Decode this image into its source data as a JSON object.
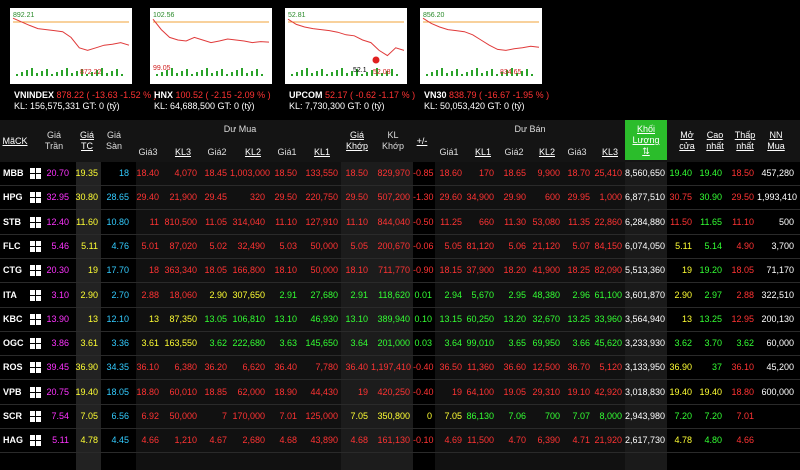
{
  "indices": [
    {
      "name": "VNINDEX",
      "price": "878.22",
      "change": "-13.63",
      "pct": "-1.52 %",
      "kl": "KL: 156,575,331",
      "gt": "GT: 0 (tỷ)",
      "hi": "892.21",
      "lo": "872.22",
      "series": [
        0.92,
        0.85,
        0.78,
        0.72,
        0.7,
        0.68,
        0.66,
        0.55,
        0.35,
        0.3,
        0.35,
        0.4,
        0.42,
        0.45,
        0.4
      ]
    },
    {
      "name": "HNX",
      "price": "100.52",
      "change": "-2.15",
      "pct": "-2.09 %",
      "kl": "KL: 64,688,500",
      "gt": "GT: 0 (tỷ)",
      "hi": "102.56",
      "lo": "99.05",
      "series": [
        0.9,
        0.7,
        0.55,
        0.5,
        0.48,
        0.55,
        0.5,
        0.45,
        0.48,
        0.52,
        0.5,
        0.48,
        0.45,
        0.47,
        0.46
      ]
    },
    {
      "name": "UPCOM",
      "price": "52.17",
      "change": "-0.62",
      "pct": "-1.17 %",
      "kl": "KL: 7,730,300",
      "gt": "GT: 0 (tỷ)",
      "hi": "52.81",
      "lo": "52.08",
      "marker": "52.1",
      "series": [
        0.9,
        0.8,
        0.75,
        0.72,
        0.7,
        0.68,
        0.65,
        0.6,
        0.58,
        0.5,
        0.45,
        0.3,
        0.2,
        0.35,
        0.3
      ]
    },
    {
      "name": "VN30",
      "price": "838.79",
      "change": "-16.67",
      "pct": "-1.95 %",
      "kl": "KL: 50,053,420",
      "gt": "GT: 0 (tỷ)",
      "hi": "856.20",
      "lo": "834.65",
      "series": [
        0.92,
        0.82,
        0.75,
        0.7,
        0.68,
        0.66,
        0.6,
        0.5,
        0.4,
        0.32,
        0.3,
        0.33,
        0.35,
        0.38,
        0.36
      ]
    }
  ],
  "headers": {
    "symbol": "MãCK",
    "tran": "Giá\nTrần",
    "tc": "Giá\nTC",
    "san": "Giá\nSàn",
    "du_mua": "Dư Mua",
    "du_ban": "Dư Bán",
    "gia3": "Giá3",
    "kl3": "KL3",
    "gia2": "Giá2",
    "kl2": "KL2",
    "gia1": "Giá1",
    "kl1": "KL1",
    "gia_khop": "Giá\nKhớp",
    "kl_khop": "KL\nKhớp",
    "pm": "+/-",
    "khoi_luong": "Khối\nLượng\n⇅",
    "mo_cua": "Mở\ncửa",
    "cao_nhat": "Cao\nnhất",
    "thap_nhat": "Thấp\nnhất",
    "nn_mua": "NN\nMua"
  },
  "rows": [
    {
      "sym": "MBB",
      "tran": "20.70",
      "tc": "19.35",
      "san": "18",
      "b3": "18.40",
      "bk3": "4,070",
      "b2": "18.45",
      "bk2": "1,003,000",
      "b1": "18.50",
      "bk1": "133,550",
      "gk": "18.50",
      "kk": "829,970",
      "pm": "-0.85",
      "s1": "18.60",
      "sk1": "170",
      "s2": "18.65",
      "sk2": "9,900",
      "s3": "18.70",
      "sk3": "25,410",
      "vol": "8,560,650",
      "mo": "19.40",
      "cao": "19.40",
      "thap": "18.50",
      "nn": "457,280",
      "c": [
        "r",
        "r",
        "r",
        "r",
        "r",
        "r",
        "r",
        "r",
        "r",
        "r",
        "r",
        "r",
        "r",
        "r",
        "g",
        "g",
        "r"
      ]
    },
    {
      "sym": "HPG",
      "tran": "32.95",
      "tc": "30.80",
      "san": "28.65",
      "b3": "29.40",
      "bk3": "21,900",
      "b2": "29.45",
      "bk2": "320",
      "b1": "29.50",
      "bk1": "220,750",
      "gk": "29.50",
      "kk": "507,200",
      "pm": "-1.30",
      "s1": "29.60",
      "sk1": "34,900",
      "s2": "29.90",
      "sk2": "600",
      "s3": "29.95",
      "sk3": "1,000",
      "vol": "6,877,510",
      "mo": "30.75",
      "cao": "30.90",
      "thap": "29.50",
      "nn": "1,993,410",
      "c": [
        "r",
        "r",
        "r",
        "r",
        "r",
        "r",
        "r",
        "r",
        "r",
        "r",
        "r",
        "r",
        "r",
        "r",
        "r",
        "g",
        "r"
      ]
    },
    {
      "sym": "STB",
      "tran": "12.40",
      "tc": "11.60",
      "san": "10.80",
      "b3": "11",
      "bk3": "810,500",
      "b2": "11.05",
      "bk2": "314,040",
      "b1": "11.10",
      "bk1": "127,910",
      "gk": "11.10",
      "kk": "844,040",
      "pm": "-0.50",
      "s1": "11.25",
      "sk1": "660",
      "s2": "11.30",
      "sk2": "53,080",
      "s3": "11.35",
      "sk3": "22,860",
      "vol": "6,284,880",
      "mo": "11.50",
      "cao": "11.65",
      "thap": "11.10",
      "nn": "500",
      "c": [
        "r",
        "r",
        "r",
        "r",
        "r",
        "r",
        "r",
        "r",
        "r",
        "r",
        "r",
        "r",
        "r",
        "r",
        "r",
        "g",
        "r"
      ]
    },
    {
      "sym": "FLC",
      "tran": "5.46",
      "tc": "5.11",
      "san": "4.76",
      "b3": "5.01",
      "bk3": "87,020",
      "b2": "5.02",
      "bk2": "32,490",
      "b1": "5.03",
      "bk1": "50,000",
      "gk": "5.05",
      "kk": "200,670",
      "pm": "-0.06",
      "s1": "5.05",
      "sk1": "81,120",
      "s2": "5.06",
      "sk2": "21,120",
      "s3": "5.07",
      "sk3": "84,150",
      "vol": "6,074,050",
      "mo": "5.11",
      "cao": "5.14",
      "thap": "4.90",
      "nn": "3,700",
      "c": [
        "r",
        "r",
        "r",
        "r",
        "r",
        "r",
        "r",
        "r",
        "r",
        "r",
        "r",
        "r",
        "r",
        "r",
        "y",
        "g",
        "r"
      ]
    },
    {
      "sym": "CTG",
      "tran": "20.30",
      "tc": "19",
      "san": "17.70",
      "b3": "18",
      "bk3": "363,340",
      "b2": "18.05",
      "bk2": "166,800",
      "b1": "18.10",
      "bk1": "50,000",
      "gk": "18.10",
      "kk": "711,770",
      "pm": "-0.90",
      "s1": "18.15",
      "sk1": "37,900",
      "s2": "18.20",
      "sk2": "41,900",
      "s3": "18.25",
      "sk3": "82,090",
      "vol": "5,513,360",
      "mo": "19",
      "cao": "19.20",
      "thap": "18.05",
      "nn": "71,170",
      "c": [
        "r",
        "r",
        "r",
        "r",
        "r",
        "r",
        "r",
        "r",
        "r",
        "r",
        "r",
        "r",
        "r",
        "r",
        "y",
        "g",
        "r"
      ]
    },
    {
      "sym": "ITA",
      "tran": "3.10",
      "tc": "2.90",
      "san": "2.70",
      "b3": "2.88",
      "bk3": "18,060",
      "b2": "2.90",
      "bk2": "307,650",
      "b1": "2.91",
      "bk1": "27,680",
      "gk": "2.91",
      "kk": "118,620",
      "pm": "0.01",
      "s1": "2.94",
      "sk1": "5,670",
      "s2": "2.95",
      "sk2": "48,380",
      "s3": "2.96",
      "sk3": "61,100",
      "vol": "3,601,870",
      "mo": "2.90",
      "cao": "2.97",
      "thap": "2.88",
      "nn": "322,510",
      "c": [
        "r",
        "r",
        "y",
        "y",
        "g",
        "g",
        "g",
        "g",
        "g",
        "g",
        "g",
        "g",
        "g",
        "g",
        "y",
        "g",
        "r"
      ]
    },
    {
      "sym": "KBC",
      "tran": "13.90",
      "tc": "13",
      "san": "12.10",
      "b3": "13",
      "bk3": "87,350",
      "b2": "13.05",
      "bk2": "106,810",
      "b1": "13.10",
      "bk1": "46,930",
      "gk": "13.10",
      "kk": "389,940",
      "pm": "0.10",
      "s1": "13.15",
      "sk1": "60,250",
      "s2": "13.20",
      "sk2": "32,670",
      "s3": "13.25",
      "sk3": "33,960",
      "vol": "3,564,940",
      "mo": "13",
      "cao": "13.25",
      "thap": "12.95",
      "nn": "200,130",
      "c": [
        "y",
        "y",
        "g",
        "g",
        "g",
        "g",
        "g",
        "g",
        "g",
        "g",
        "g",
        "g",
        "g",
        "g",
        "y",
        "g",
        "r"
      ]
    },
    {
      "sym": "OGC",
      "tran": "3.86",
      "tc": "3.61",
      "san": "3.36",
      "b3": "3.61",
      "bk3": "163,550",
      "b2": "3.62",
      "bk2": "222,680",
      "b1": "3.63",
      "bk1": "145,650",
      "gk": "3.64",
      "kk": "201,000",
      "pm": "0.03",
      "s1": "3.64",
      "sk1": "99,010",
      "s2": "3.65",
      "sk2": "69,950",
      "s3": "3.66",
      "sk3": "45,620",
      "vol": "3,233,930",
      "mo": "3.62",
      "cao": "3.70",
      "thap": "3.62",
      "nn": "60,000",
      "c": [
        "y",
        "y",
        "g",
        "g",
        "g",
        "g",
        "g",
        "g",
        "g",
        "g",
        "g",
        "g",
        "g",
        "g",
        "g",
        "g",
        "g"
      ]
    },
    {
      "sym": "ROS",
      "tran": "39.45",
      "tc": "36.90",
      "san": "34.35",
      "b3": "36.10",
      "bk3": "6,380",
      "b2": "36.20",
      "bk2": "6,620",
      "b1": "36.40",
      "bk1": "7,780",
      "gk": "36.40",
      "kk": "1,197,410",
      "pm": "-0.40",
      "s1": "36.50",
      "sk1": "11,360",
      "s2": "36.60",
      "sk2": "12,500",
      "s3": "36.70",
      "sk3": "5,120",
      "vol": "3,133,950",
      "mo": "36.90",
      "cao": "37",
      "thap": "36.10",
      "nn": "45,200",
      "c": [
        "r",
        "r",
        "r",
        "r",
        "r",
        "r",
        "r",
        "r",
        "r",
        "r",
        "r",
        "r",
        "r",
        "r",
        "y",
        "g",
        "r"
      ]
    },
    {
      "sym": "VPB",
      "tran": "20.75",
      "tc": "19.40",
      "san": "18.05",
      "b3": "18.80",
      "bk3": "60,010",
      "b2": "18.85",
      "bk2": "62,000",
      "b1": "18.90",
      "bk1": "44,430",
      "gk": "19",
      "kk": "420,250",
      "pm": "-0.40",
      "s1": "19",
      "sk1": "64,100",
      "s2": "19.05",
      "sk2": "29,310",
      "s3": "19.10",
      "sk3": "42,920",
      "vol": "3,018,830",
      "mo": "19.40",
      "cao": "19.40",
      "thap": "18.80",
      "nn": "600,000",
      "c": [
        "r",
        "r",
        "r",
        "r",
        "r",
        "r",
        "r",
        "r",
        "r",
        "r",
        "r",
        "r",
        "r",
        "r",
        "y",
        "y",
        "r"
      ]
    },
    {
      "sym": "SCR",
      "tran": "7.54",
      "tc": "7.05",
      "san": "6.56",
      "b3": "6.92",
      "bk3": "50,000",
      "b2": "7",
      "bk2": "170,000",
      "b1": "7.01",
      "bk1": "125,000",
      "gk": "7.05",
      "kk": "350,800",
      "pm": "0",
      "s1": "7.05",
      "sk1": "86,130",
      "s2": "7.06",
      "sk2": "700",
      "s3": "7.07",
      "sk3": "8,000",
      "vol": "2,943,980",
      "mo": "7.20",
      "cao": "7.20",
      "thap": "7.01",
      "nn": "",
      "c": [
        "r",
        "r",
        "r",
        "r",
        "r",
        "r",
        "y",
        "y",
        "y",
        "y",
        "g",
        "g",
        "g",
        "g",
        "g",
        "g",
        "r"
      ]
    },
    {
      "sym": "HAG",
      "tran": "5.11",
      "tc": "4.78",
      "san": "4.45",
      "b3": "4.66",
      "bk3": "1,210",
      "b2": "4.67",
      "bk2": "2,680",
      "b1": "4.68",
      "bk1": "43,890",
      "gk": "4.68",
      "kk": "161,130",
      "pm": "-0.10",
      "s1": "4.69",
      "sk1": "11,500",
      "s2": "4.70",
      "sk2": "6,390",
      "s3": "4.71",
      "sk3": "21,920",
      "vol": "2,617,730",
      "mo": "4.78",
      "cao": "4.80",
      "thap": "4.66",
      "nn": "",
      "c": [
        "r",
        "r",
        "r",
        "r",
        "r",
        "r",
        "r",
        "r",
        "r",
        "r",
        "r",
        "r",
        "r",
        "r",
        "y",
        "g",
        "r"
      ]
    }
  ],
  "colors": {
    "r": "#ff3333",
    "g": "#33ff33",
    "y": "#ffff33",
    "tran": "#ff33ff",
    "san": "#33ccff",
    "tc": "#ffff33",
    "accent": "#2bbd2b"
  }
}
